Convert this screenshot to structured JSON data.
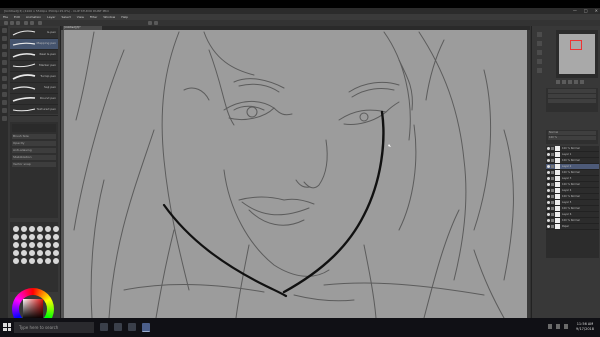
{
  "window": {
    "title": "[Untitled](3) (4100 x 5500px 350dpi 25.0%) - CLIP STUDIO PAINT PRO",
    "controls": [
      "—",
      "□",
      "✕"
    ]
  },
  "menu": {
    "items": [
      "File",
      "Edit",
      "Animation",
      "Layer",
      "Select",
      "View",
      "Filter",
      "Window",
      "Help"
    ]
  },
  "document": {
    "tab_label": "[Untitled](3)*"
  },
  "subtool_panel": {
    "brushes": [
      {
        "label": "G-pen"
      },
      {
        "label": "Mapping pen"
      },
      {
        "label": "Real G-pen"
      },
      {
        "label": "Marker pen"
      },
      {
        "label": "Turnip pen"
      },
      {
        "label": "Saji pen"
      },
      {
        "label": "Round pen"
      },
      {
        "label": "Textured pen"
      }
    ]
  },
  "tool_property": {
    "rows": [
      "Brush Size",
      "Opacity",
      "Anti-aliasing",
      "Stabilization",
      "Vector snap"
    ]
  },
  "brush_size_count": 30,
  "color": {
    "main": "#000000",
    "sub": "#ffffff",
    "accent": "#d11a1a"
  },
  "layer_panel": {
    "rows": [
      "Normal",
      "100 %",
      "Normal"
    ],
    "layers": [
      {
        "name": "100 % Normal",
        "selected": false
      },
      {
        "name": "Layer 1",
        "selected": false
      },
      {
        "name": "100 % Normal",
        "selected": false
      },
      {
        "name": "Layer 2",
        "selected": true
      },
      {
        "name": "100 % Normal",
        "selected": false
      },
      {
        "name": "Layer 3",
        "selected": false
      },
      {
        "name": "100 % Normal",
        "selected": false
      },
      {
        "name": "Layer 4",
        "selected": false
      },
      {
        "name": "100 % Normal",
        "selected": false
      },
      {
        "name": "Layer 5",
        "selected": false
      },
      {
        "name": "100 % Normal",
        "selected": false
      },
      {
        "name": "Layer 6",
        "selected": false
      },
      {
        "name": "100 % Normal",
        "selected": false
      },
      {
        "name": "Paper",
        "selected": false
      }
    ]
  },
  "taskbar": {
    "search_placeholder": "Type here to search",
    "time": "11:56 AM",
    "date": "9/17/2018"
  }
}
